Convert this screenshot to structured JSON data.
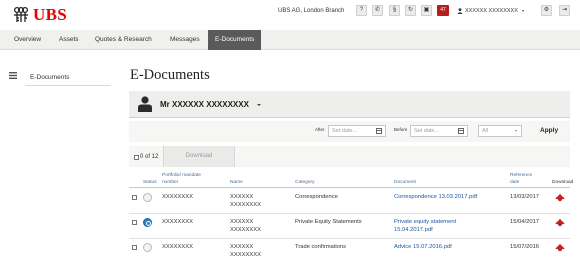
{
  "brand": {
    "name": "UBS",
    "color": "#e60000",
    "icon": "ubs-keys-logo"
  },
  "header": {
    "branch": "UBS AG, London Branch",
    "tools": [
      {
        "icon": "help-icon",
        "glyph": "?"
      },
      {
        "icon": "phone-icon",
        "glyph": "✆"
      },
      {
        "icon": "section-icon",
        "glyph": "§"
      },
      {
        "icon": "refresh-icon",
        "glyph": "↻"
      },
      {
        "icon": "print-icon",
        "glyph": "▣"
      }
    ],
    "mail_count": "47",
    "user_label": "XXXXXX XXXXXXXX",
    "settings_glyph": "⚙",
    "logout_glyph": "⇥"
  },
  "nav": {
    "tabs": [
      {
        "label": "Overview",
        "active": false
      },
      {
        "label": "Assets",
        "active": false
      },
      {
        "label": "Quotes & Research",
        "active": false
      },
      {
        "label": "Messages",
        "active": false
      },
      {
        "label": "E-Documents",
        "active": true
      }
    ],
    "active_color": "#5a5a5a"
  },
  "sidebar": {
    "items": [
      {
        "label": "E-Documents"
      }
    ]
  },
  "page": {
    "title": "E-Documents"
  },
  "account": {
    "name": "Mr XXXXXX XXXXXXXX"
  },
  "filters": {
    "after_label": "After",
    "after_placeholder": "Set date...",
    "before_label": "Before",
    "before_placeholder": "Set date...",
    "type_value": "All",
    "apply_label": "Apply"
  },
  "list": {
    "count_text": "0 of 12",
    "download_label": "Download"
  },
  "table": {
    "headers": {
      "status": "Status",
      "portfolio_l1": "Portfolio/ mandate",
      "portfolio_l2": "number",
      "name": "Name",
      "category": "Category",
      "document": "Document",
      "refdate_l1": "Reference",
      "refdate_l2": "date",
      "download": "Download"
    },
    "rows": [
      {
        "status": "read",
        "portfolio": "XXXXXXXX",
        "name_l1": "XXXXXX",
        "name_l2": "XXXXXXXX",
        "category": "Correspondence",
        "doc_l1": "Correspondence 13.03.2017.pdf",
        "doc_l2": "",
        "date": "13/03/2017"
      },
      {
        "status": "new",
        "portfolio": "XXXXXXXX",
        "name_l1": "XXXXXX",
        "name_l2": "XXXXXXXX",
        "category": "Private Equity Statements",
        "doc_l1": "Private equity statement",
        "doc_l2": "15.04.2017.pdf",
        "date": "15/04/2017"
      },
      {
        "status": "read",
        "portfolio": "XXXXXXXX",
        "name_l1": "XXXXXX",
        "name_l2": "XXXXXXXX",
        "category": "Trade confirmations",
        "doc_l1": "Advice 15.07.2016.pdf",
        "doc_l2": "",
        "date": "15/07/2016"
      }
    ]
  }
}
